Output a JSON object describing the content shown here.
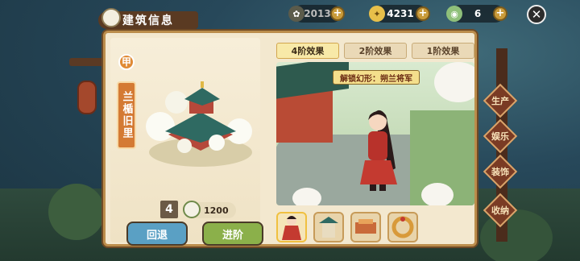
{
  "top_bar": {
    "resource_1": {
      "value": "2013"
    },
    "resource_2": {
      "value": "4231"
    },
    "resource_3": {
      "value": "6"
    },
    "plus_label": "+",
    "close_label": "✕"
  },
  "title": "建筑信息",
  "building": {
    "tier_badge": "甲",
    "name": "兰楯旧里",
    "level": "4",
    "cost": "1200"
  },
  "buttons": {
    "back_label": "回退",
    "upgrade_label": "进阶"
  },
  "tabs": [
    {
      "label": "4阶效果",
      "active": true
    },
    {
      "label": "2阶效果",
      "active": false
    },
    {
      "label": "1阶效果",
      "active": false
    }
  ],
  "unlock_tag": "解锁幻形：朔兰将军",
  "side_menu": [
    "生产",
    "娱乐",
    "装饰",
    "收纳"
  ],
  "colors": {
    "panel": "#f3e8cf",
    "border": "#bb8d4c",
    "back_button": "#5aa0c4",
    "upgrade_button": "#8bb04a",
    "tab_active": "#f8e9a8"
  }
}
